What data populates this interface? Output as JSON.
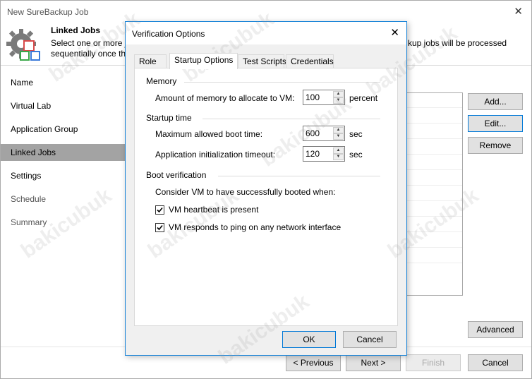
{
  "wizard": {
    "title": "New SureBackup Job",
    "header_title": "Linked Jobs",
    "header_desc_line1": "Select one or more j",
    "header_desc_line2": "sequentially once th",
    "header_desc_right": "kup jobs will be processed",
    "nav": [
      {
        "label": "Name",
        "state": "normal"
      },
      {
        "label": "Virtual Lab",
        "state": "normal"
      },
      {
        "label": "Application Group",
        "state": "normal"
      },
      {
        "label": "Linked Jobs",
        "state": "active"
      },
      {
        "label": "Settings",
        "state": "normal"
      },
      {
        "label": "Schedule",
        "state": "dim"
      },
      {
        "label": "Summary",
        "state": "dim"
      }
    ],
    "buttons": {
      "add": "Add...",
      "edit": "Edit...",
      "remove": "Remove",
      "advanced": "Advanced",
      "previous": "< Previous",
      "next": "Next >",
      "finish": "Finish",
      "cancel": "Cancel"
    }
  },
  "dialog": {
    "title": "Verification Options",
    "tabs": [
      "Role",
      "Startup Options",
      "Test Scripts",
      "Credentials"
    ],
    "active_tab": "Startup Options",
    "memory": {
      "group": "Memory",
      "label": "Amount of memory to allocate to VM:",
      "value": "100",
      "unit": "percent"
    },
    "startup": {
      "group": "Startup time",
      "boot_label": "Maximum allowed boot time:",
      "boot_value": "600",
      "boot_unit": "sec",
      "init_label": "Application initialization timeout:",
      "init_value": "120",
      "init_unit": "sec"
    },
    "boot": {
      "group": "Boot verification",
      "intro": "Consider VM to have successfully booted when:",
      "heartbeat_label": "VM heartbeat is present",
      "heartbeat_checked": true,
      "ping_label": "VM responds to ping on any network interface",
      "ping_checked": true
    },
    "ok": "OK",
    "cancel": "Cancel"
  },
  "watermark_text": "bakicubuk"
}
